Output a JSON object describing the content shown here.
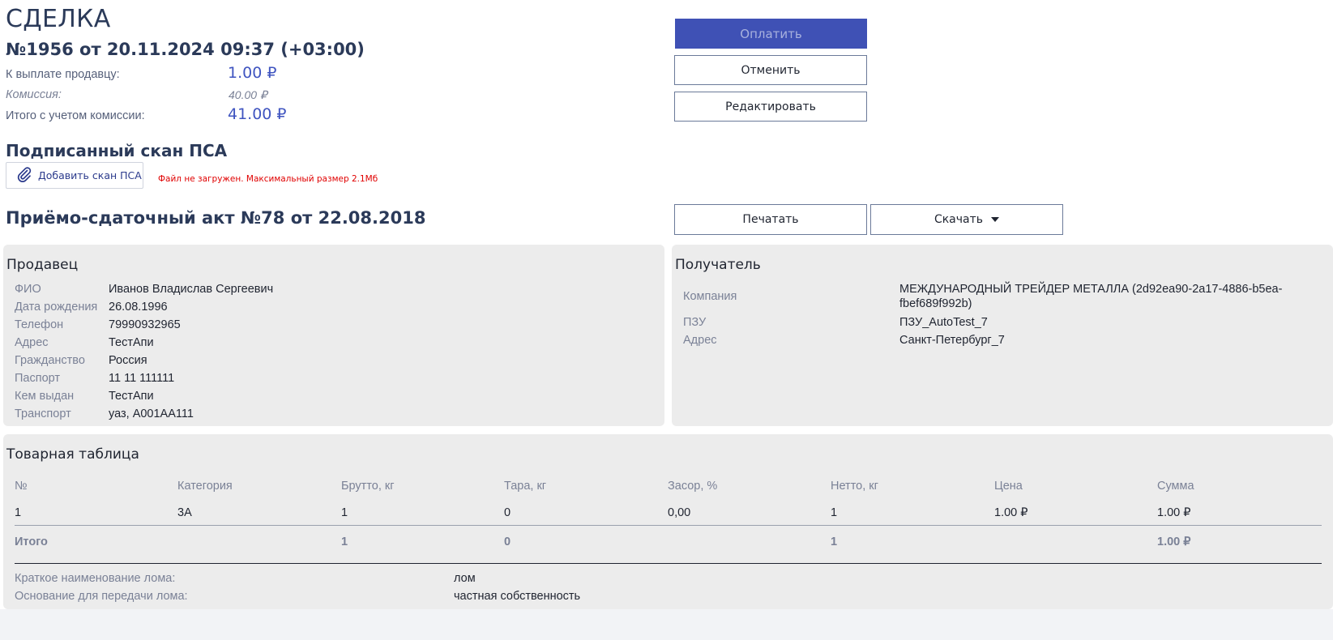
{
  "deal": {
    "title": "СДЕЛКА",
    "subtitle": "№1956 от 20.11.2024 09:37 (+03:00)",
    "payout_label": "К выплате продавцу:",
    "payout_value": "1.00 ₽",
    "commission_label": "Комиссия:",
    "commission_value": "40.00 ₽",
    "total_label": "Итого с учетом комиссии:",
    "total_value": "41.00 ₽"
  },
  "actions": {
    "pay": "Оплатить",
    "cancel": "Отменить",
    "edit": "Редактировать",
    "print": "Печатать",
    "download": "Скачать"
  },
  "scan": {
    "heading": "Подписанный скан ПСА",
    "add_button": "Добавить скан ПСА",
    "error": "Файл не загружен. Максимальный размер 2.1Мб"
  },
  "act": {
    "heading": "Приёмо-сдаточный акт №78 от 22.08.2018"
  },
  "seller": {
    "title": "Продавец",
    "fields": [
      {
        "label": "ФИО",
        "value": "Иванов Владислав Сергеевич"
      },
      {
        "label": "Дата рождения",
        "value": "26.08.1996"
      },
      {
        "label": "Телефон",
        "value": "79990932965"
      },
      {
        "label": "Адрес",
        "value": "ТестАпи"
      },
      {
        "label": "Гражданство",
        "value": "Россия"
      },
      {
        "label": "Паспорт",
        "value": "11 11 111111"
      },
      {
        "label": "Кем выдан",
        "value": "ТестАпи"
      },
      {
        "label": "Транспорт",
        "value": "уаз, А001АА111"
      }
    ]
  },
  "recipient": {
    "title": "Получатель",
    "fields": [
      {
        "label": "Компания",
        "value_line1": "МЕЖДУНАРОДНЫЙ ТРЕЙДЕР МЕТАЛЛА (2d92ea90-2a17-4886-b5ea-",
        "value_line2": "fbef689f992b)"
      },
      {
        "label": "ПЗУ",
        "value": "ПЗУ_AutoTest_7"
      },
      {
        "label": "Адрес",
        "value": "Санкт-Петербург_7"
      }
    ]
  },
  "goods": {
    "title": "Товарная таблица",
    "columns": [
      "№",
      "Категория",
      "Брутто, кг",
      "Тара, кг",
      "Засор, %",
      "Нетто, кг",
      "Цена",
      "Сумма"
    ],
    "rows": [
      [
        "1",
        "3А",
        "1",
        "0",
        "0,00",
        "1",
        "1.00 ₽",
        "1.00 ₽"
      ]
    ],
    "totals": {
      "label": "Итого",
      "gross": "1",
      "tare": "0",
      "net": "1",
      "sum": "1.00 ₽"
    },
    "short_name_label": "Краткое наименование лома:",
    "short_name_value": "лом",
    "basis_label": "Основание для передачи лома:",
    "basis_value": "частная собственность"
  },
  "colors": {
    "primary": "#3f51b5",
    "heading": "#2b3a59",
    "error": "#e00000",
    "panel": "#ececec"
  }
}
